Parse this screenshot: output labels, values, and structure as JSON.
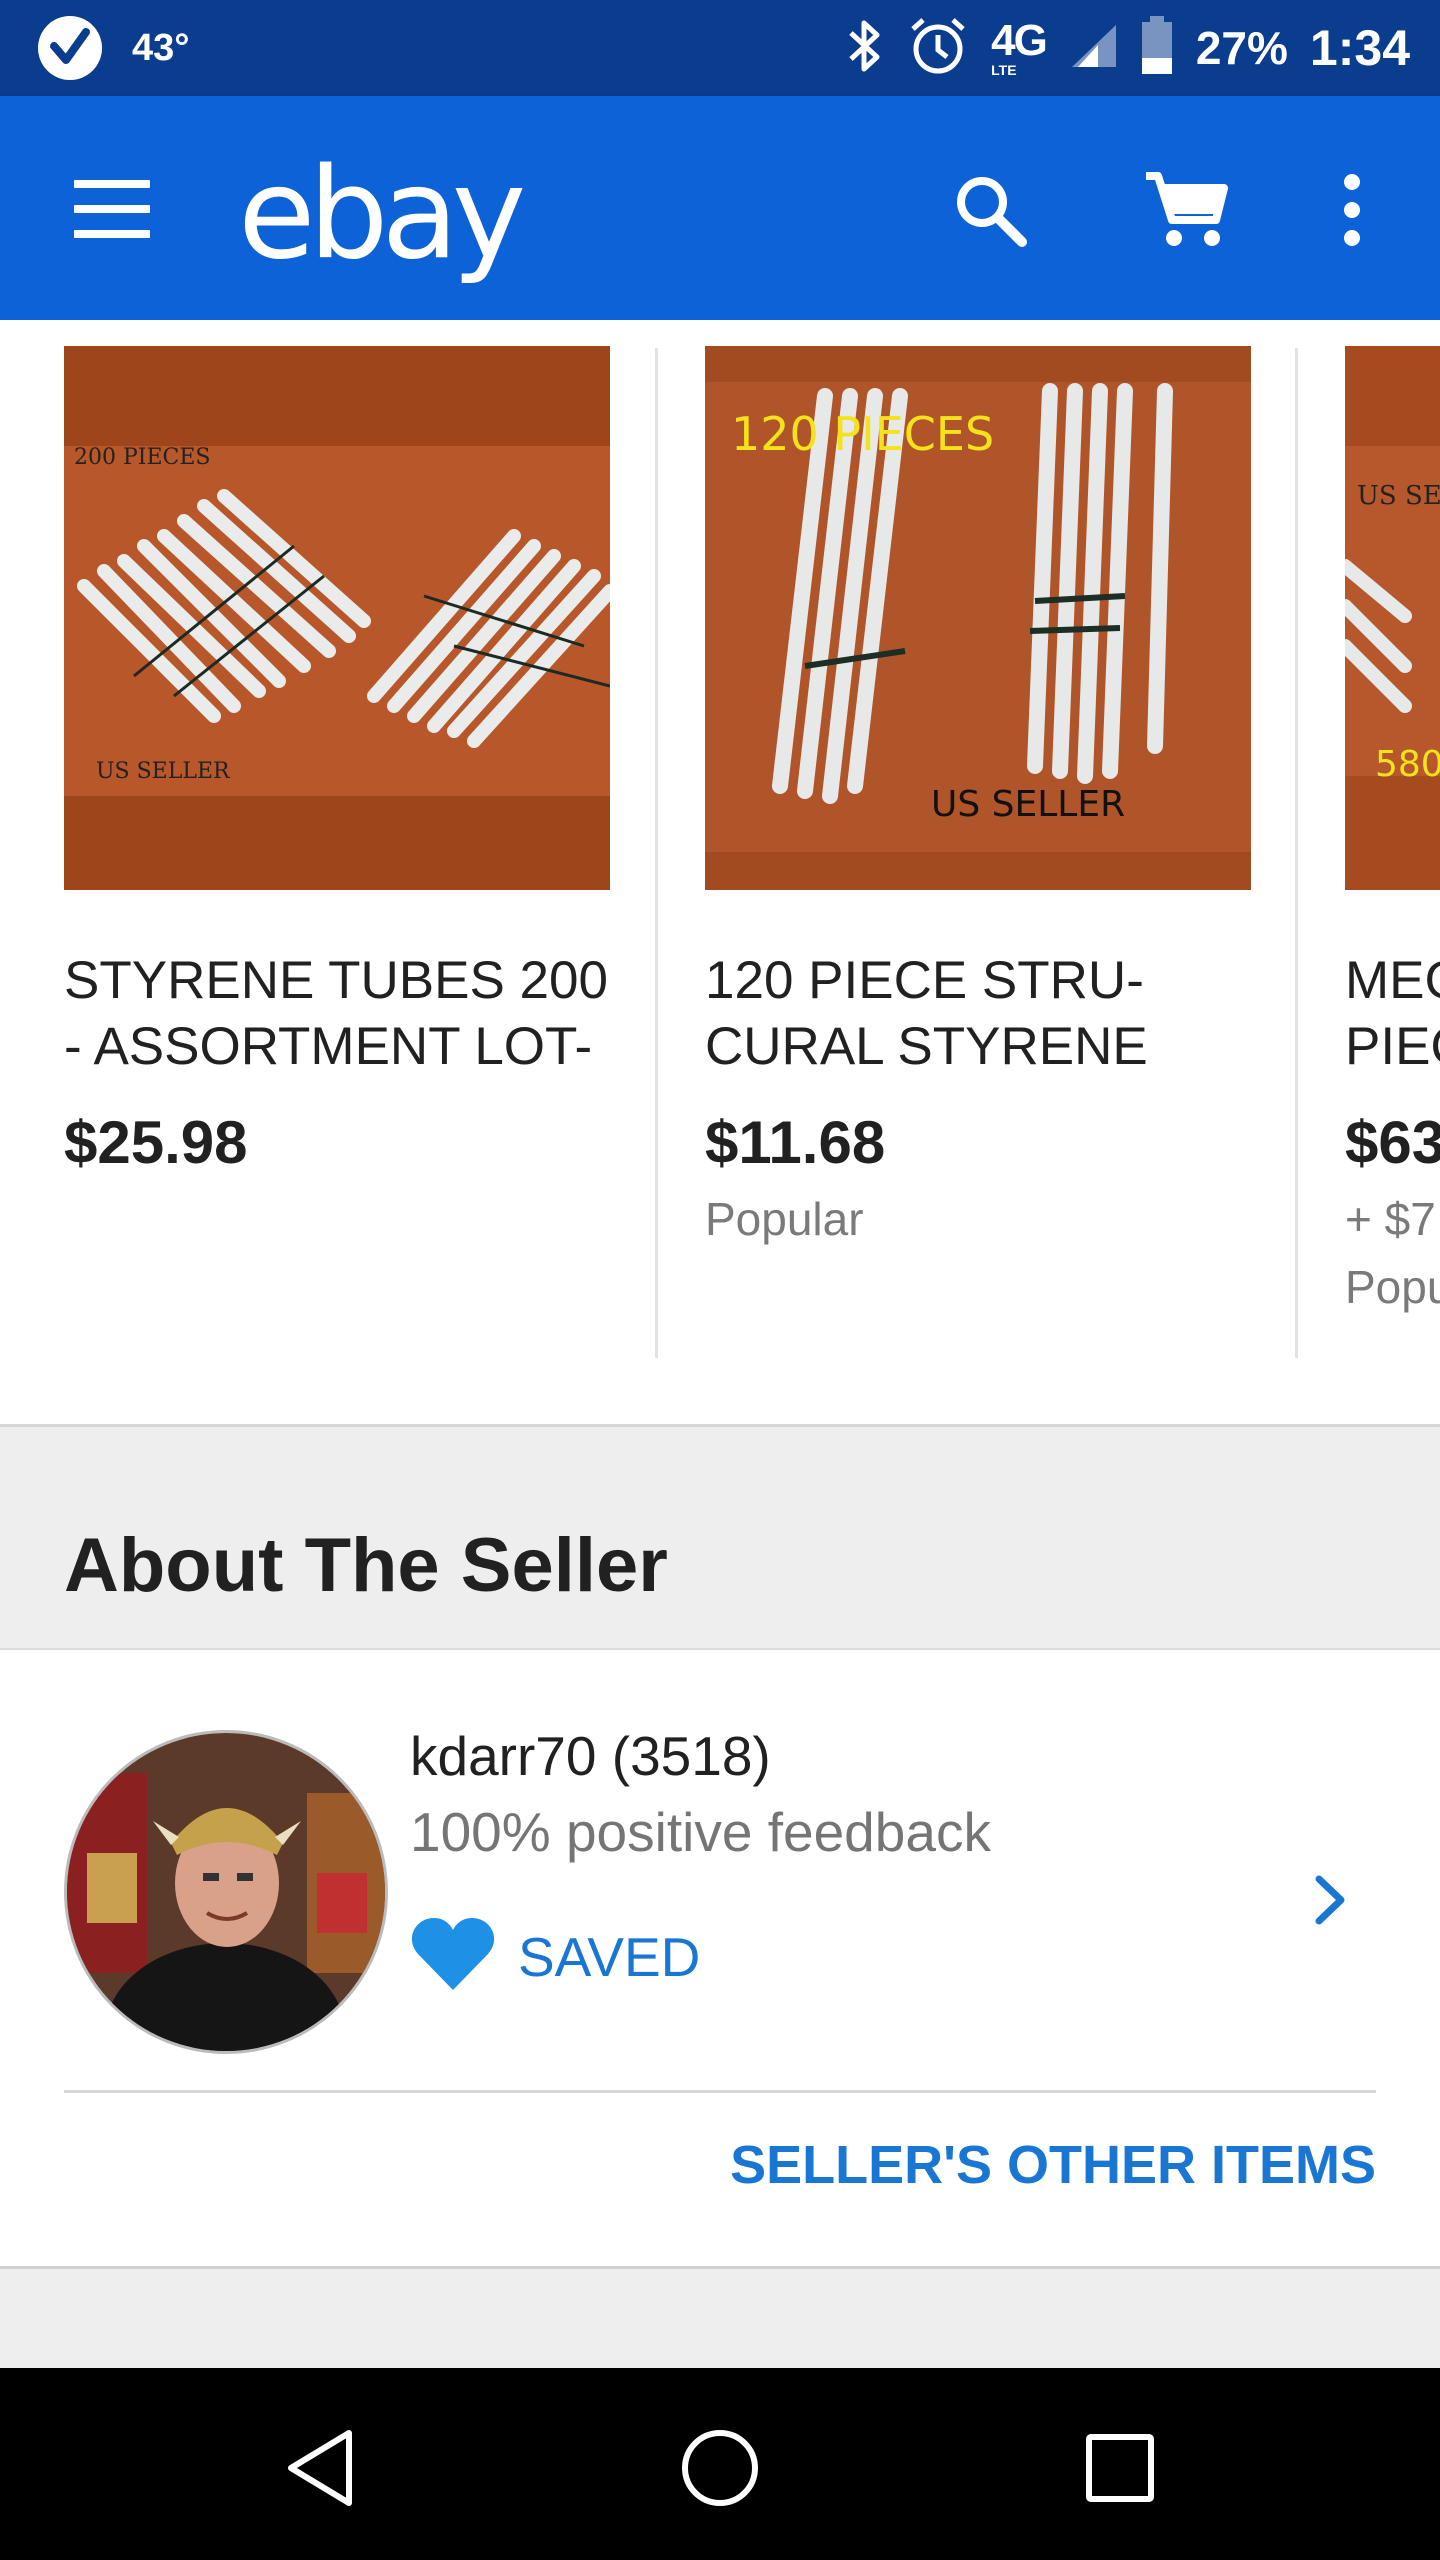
{
  "status_bar": {
    "temperature": "43°",
    "network": "4G",
    "network_sub": "LTE",
    "battery": "27%",
    "time": "1:34"
  },
  "app_bar": {
    "logo": "ebay",
    "icons": [
      "menu-icon",
      "search-icon",
      "cart-icon",
      "more-vert-icon"
    ]
  },
  "carousel": {
    "items": [
      {
        "image_caption_top": "200 PIECES",
        "image_caption_bottom": "US SELLER",
        "title": "STYRENE TUBES 200 -  ASSORTMENT LOT-",
        "price": "$25.98",
        "shipping": "",
        "badge": ""
      },
      {
        "image_caption_top": "120 PIECES",
        "image_caption_bottom": "US SELLER",
        "title": "120 PIECE STRU- CURAL STYRENE",
        "price": "$11.68",
        "shipping": "",
        "badge": "Popular"
      },
      {
        "image_caption_top": "US SE",
        "image_caption_bottom": "580",
        "title": "MEG PIEC",
        "price": "$63",
        "shipping": "+ $7",
        "badge": "Popu"
      }
    ]
  },
  "about_seller": {
    "heading": "About The Seller",
    "seller_name": "kdarr70 (3518)",
    "feedback": "100% positive feedback",
    "saved_label": "SAVED",
    "other_items_label": "SELLER'S OTHER ITEMS"
  },
  "colors": {
    "status_bar": "#0b3d8f",
    "app_bar": "#0c62d6",
    "accent_blue": "#1976d2",
    "heart": "#1e90e6",
    "thumb_bg": "#a3481f"
  },
  "nav_bar": {
    "icons": [
      "back-icon",
      "home-icon",
      "recents-icon"
    ]
  }
}
